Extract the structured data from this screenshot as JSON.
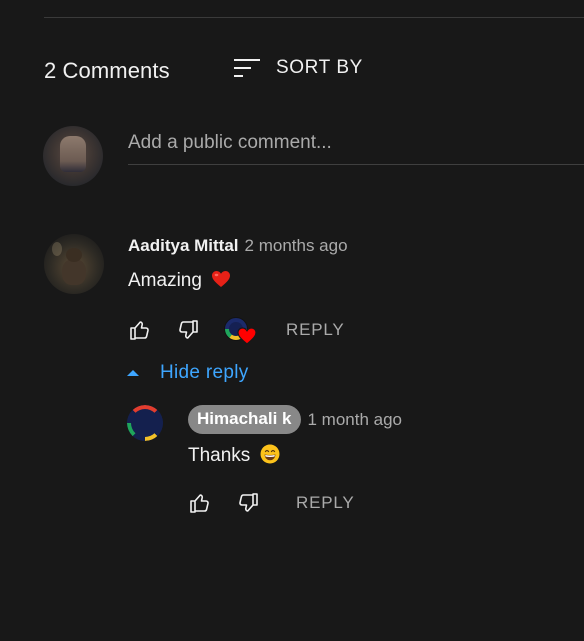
{
  "header": {
    "comments_count_label": "2 Comments",
    "sort_label": "SORT BY"
  },
  "composer": {
    "placeholder": "Add a public comment..."
  },
  "comments": [
    {
      "author": "Aaditya Mittal",
      "time": "2 months ago",
      "text": "Amazing",
      "emoji": "red-heart",
      "reply_label": "REPLY",
      "creator_hearted": true,
      "toggle_replies_label": "Hide reply",
      "replies": [
        {
          "author": "Himachali k",
          "author_avatar_text": "Himachali k",
          "is_creator": true,
          "time": "1 month ago",
          "text": "Thanks",
          "emoji": "grinning-face",
          "reply_label": "REPLY"
        }
      ]
    }
  ],
  "colors": {
    "background": "#181818",
    "primary_text": "#f1f1f1",
    "secondary_text": "#aaaaaa",
    "link_blue": "#3ea6ff",
    "creator_chip": "#888888",
    "heart_red": "#e62117"
  }
}
